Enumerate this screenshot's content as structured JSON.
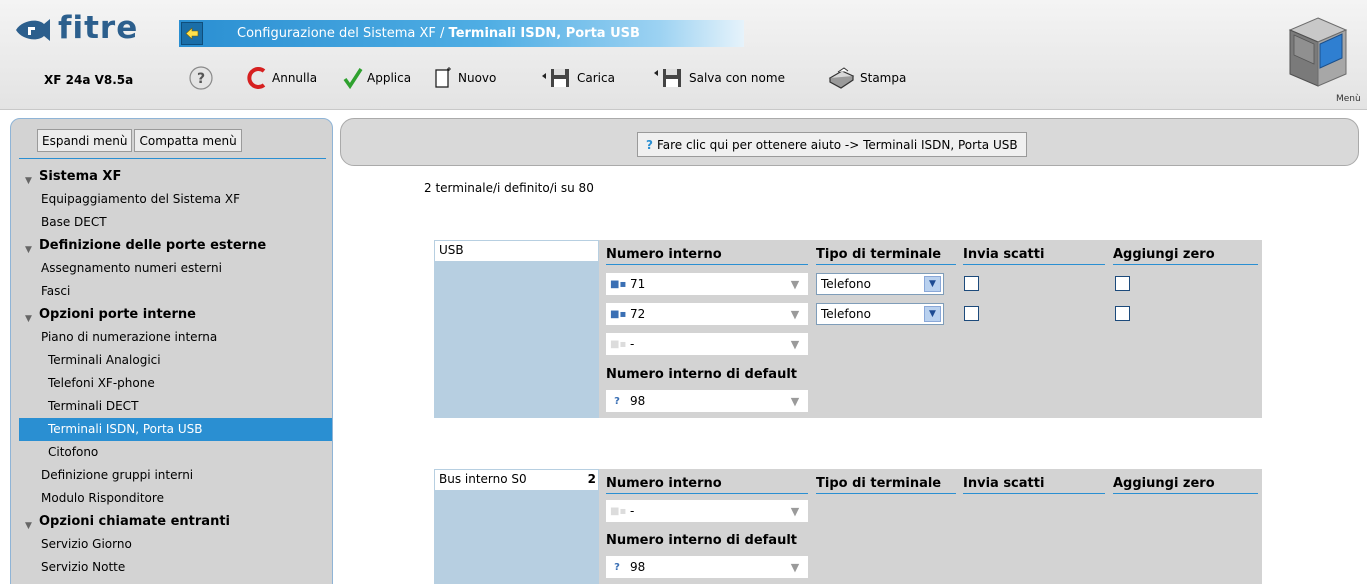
{
  "app": {
    "logo_text": "fitre",
    "title_prefix": "Configurazione del Sistema XF / ",
    "title_page": "Terminali ISDN, Porta USB",
    "version": "XF 24a V8.5a",
    "menu_label": "Menù"
  },
  "toolbar": {
    "undo": "Annulla",
    "apply": "Applica",
    "new": "Nuovo",
    "load": "Carica",
    "save_as": "Salva con nome",
    "print": "Stampa"
  },
  "sidebar": {
    "expand": "Espandi menù",
    "collapse": "Compatta menù",
    "items": [
      {
        "label": "Sistema XF",
        "kind": "section"
      },
      {
        "label": "Equipaggiamento del Sistema XF",
        "kind": "item"
      },
      {
        "label": "Base DECT",
        "kind": "item"
      },
      {
        "label": "Definizione delle porte esterne",
        "kind": "section"
      },
      {
        "label": "Assegnamento numeri esterni",
        "kind": "item"
      },
      {
        "label": "Fasci",
        "kind": "item"
      },
      {
        "label": "Opzioni porte interne",
        "kind": "section"
      },
      {
        "label": "Piano di numerazione interna",
        "kind": "item"
      },
      {
        "label": "Terminali Analogici",
        "kind": "sub"
      },
      {
        "label": "Telefoni XF-phone",
        "kind": "sub"
      },
      {
        "label": "Terminali DECT",
        "kind": "sub"
      },
      {
        "label": "Terminali ISDN, Porta USB",
        "kind": "active"
      },
      {
        "label": "Citofono",
        "kind": "sub"
      },
      {
        "label": "Definizione gruppi interni",
        "kind": "item"
      },
      {
        "label": "Modulo Risponditore",
        "kind": "item"
      },
      {
        "label": "Opzioni chiamate entranti",
        "kind": "section"
      },
      {
        "label": "Servizio Giorno",
        "kind": "item"
      },
      {
        "label": "Servizio Notte",
        "kind": "item"
      }
    ]
  },
  "help": {
    "text": "Fare clic qui per ottenere aiuto -> Terminali ISDN, Porta USB"
  },
  "summary": {
    "text": "2 terminale/i definito/i su 80"
  },
  "columns": {
    "ext": "Numero interno",
    "type": "Tipo di terminale",
    "charge": "Invia scatti",
    "zero": "Aggiungi zero",
    "default": "Numero interno di default"
  },
  "usb": {
    "name": "USB",
    "rows": [
      {
        "ext": "71",
        "type": "Telefono"
      },
      {
        "ext": "72",
        "type": "Telefono"
      },
      {
        "ext": "-"
      }
    ],
    "default_ext": "98"
  },
  "bus": {
    "name": "Bus interno S0",
    "number": "2",
    "rows": [
      {
        "ext": "-"
      }
    ],
    "default_ext": "98"
  }
}
